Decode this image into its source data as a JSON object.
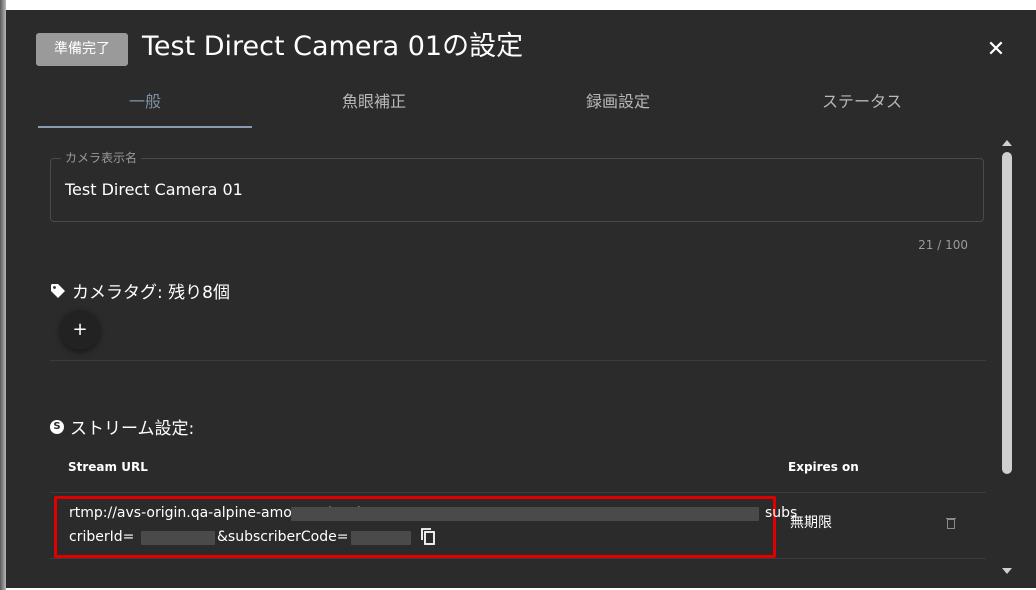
{
  "dialog": {
    "badge": "準備完了",
    "title": "Test Direct Camera 01の設定",
    "close_label": "✕"
  },
  "tabs": [
    {
      "label": "一般",
      "active": true
    },
    {
      "label": "魚眼補正",
      "active": false
    },
    {
      "label": "録画設定",
      "active": false
    },
    {
      "label": "ステータス",
      "active": false
    }
  ],
  "display_name": {
    "label": "カメラ表示名",
    "value": "Test Direct Camera 01",
    "counter": "21 / 100"
  },
  "camera_tags": {
    "heading": "カメラタグ: 残り8個",
    "add_label": "+"
  },
  "stream": {
    "heading": "ストリーム設定:",
    "icon_letter": "S",
    "columns": {
      "url": "Stream URL",
      "expires": "Expires on"
    },
    "row": {
      "url_part1": "rtmp://avs-origin.qa-alpine-amo.com/avs/rtmp_",
      "url_part2": "subs",
      "url_part3": "criberId=",
      "url_part4": "&subscriberCode=",
      "expires": "無期限"
    }
  },
  "colors": {
    "background": "#2b2b2b",
    "highlight": "#e00000",
    "badge": "#9a9a9a"
  }
}
